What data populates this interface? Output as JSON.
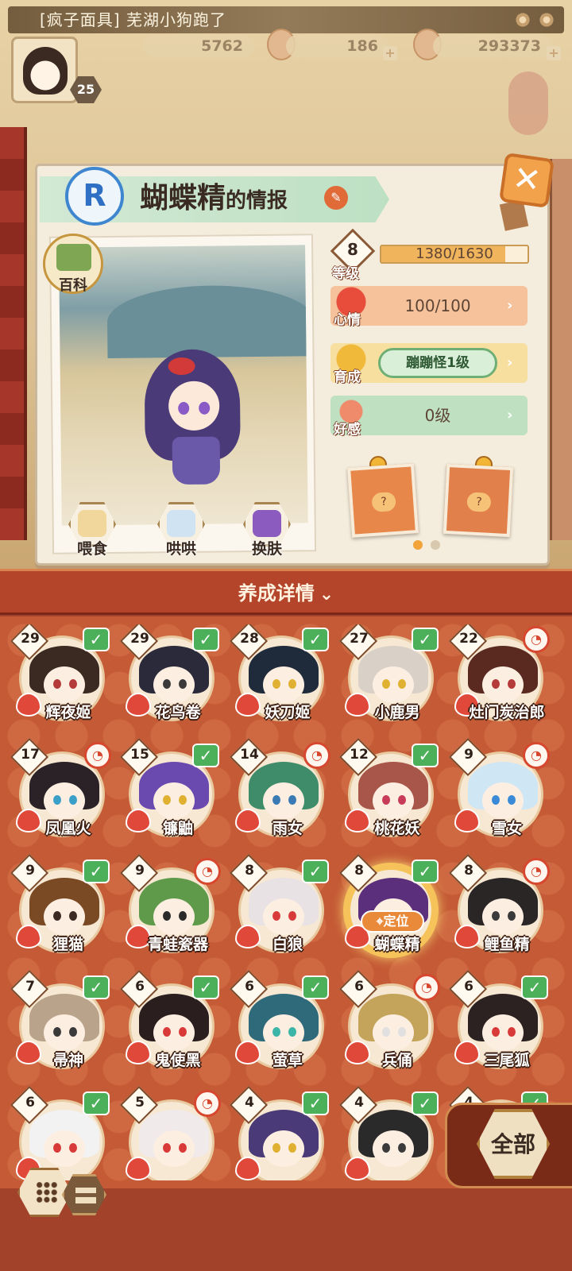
{
  "notification": "[疯子面具] 芜湖小狗跑了",
  "player": {
    "level": "25"
  },
  "resources": [
    {
      "name": "resource-1",
      "value": "5762"
    },
    {
      "name": "resource-2",
      "value": "186"
    },
    {
      "name": "resource-3",
      "value": "293373"
    }
  ],
  "info": {
    "rarity": "R",
    "name": "蝴蝶精",
    "title_suffix": "的情报",
    "baike_label": "百科",
    "level": "8",
    "level_label": "等级",
    "exp_text": "1380/1630",
    "exp_fraction": 0.847,
    "mood_label": "心情",
    "mood_value": "100/100",
    "raise_label": "育成",
    "raise_value": "蹦蹦怪1级",
    "favor_label": "好感",
    "favor_value": "0级",
    "actions": [
      "喂食",
      "哄哄",
      "换肤"
    ]
  },
  "section": {
    "title": "养成详情",
    "chevron": "⌄"
  },
  "locate_label": "定位",
  "all_button": "全部",
  "colors": {
    "accent": "#c45a36",
    "check": "#4cb05a",
    "status": "#d7472f"
  },
  "characters": [
    {
      "name": "辉夜姬",
      "level": "29",
      "status": "check"
    },
    {
      "name": "花鸟卷",
      "level": "29",
      "status": "check"
    },
    {
      "name": "妖刀姬",
      "level": "28",
      "status": "check"
    },
    {
      "name": "小鹿男",
      "level": "27",
      "status": "check"
    },
    {
      "name": "灶门炭治郎",
      "level": "22",
      "status": "icon"
    },
    {
      "name": "凤凰火",
      "level": "17",
      "status": "icon"
    },
    {
      "name": "镰鼬",
      "level": "15",
      "status": "check"
    },
    {
      "name": "雨女",
      "level": "14",
      "status": "icon"
    },
    {
      "name": "桃花妖",
      "level": "12",
      "status": "check"
    },
    {
      "name": "雪女",
      "level": "9",
      "status": "icon"
    },
    {
      "name": "狸猫",
      "level": "9",
      "status": "check"
    },
    {
      "name": "青蛙瓷器",
      "level": "9",
      "status": "icon"
    },
    {
      "name": "白狼",
      "level": "8",
      "status": "check"
    },
    {
      "name": "蝴蝶精",
      "level": "8",
      "status": "check"
    },
    {
      "name": "鲤鱼精",
      "level": "8",
      "status": "icon"
    },
    {
      "name": "帚神",
      "level": "7",
      "status": "check"
    },
    {
      "name": "鬼使黑",
      "level": "6",
      "status": "check"
    },
    {
      "name": "萤草",
      "level": "6",
      "status": "check"
    },
    {
      "name": "兵俑",
      "level": "6",
      "status": "icon"
    },
    {
      "name": "三尾狐",
      "level": "6",
      "status": "check"
    },
    {
      "name": "",
      "level": "6",
      "status": "check"
    },
    {
      "name": "",
      "level": "5",
      "status": "icon"
    },
    {
      "name": "",
      "level": "4",
      "status": "check"
    },
    {
      "name": "",
      "level": "4",
      "status": "check"
    },
    {
      "name": "",
      "level": "4",
      "status": "check"
    }
  ]
}
